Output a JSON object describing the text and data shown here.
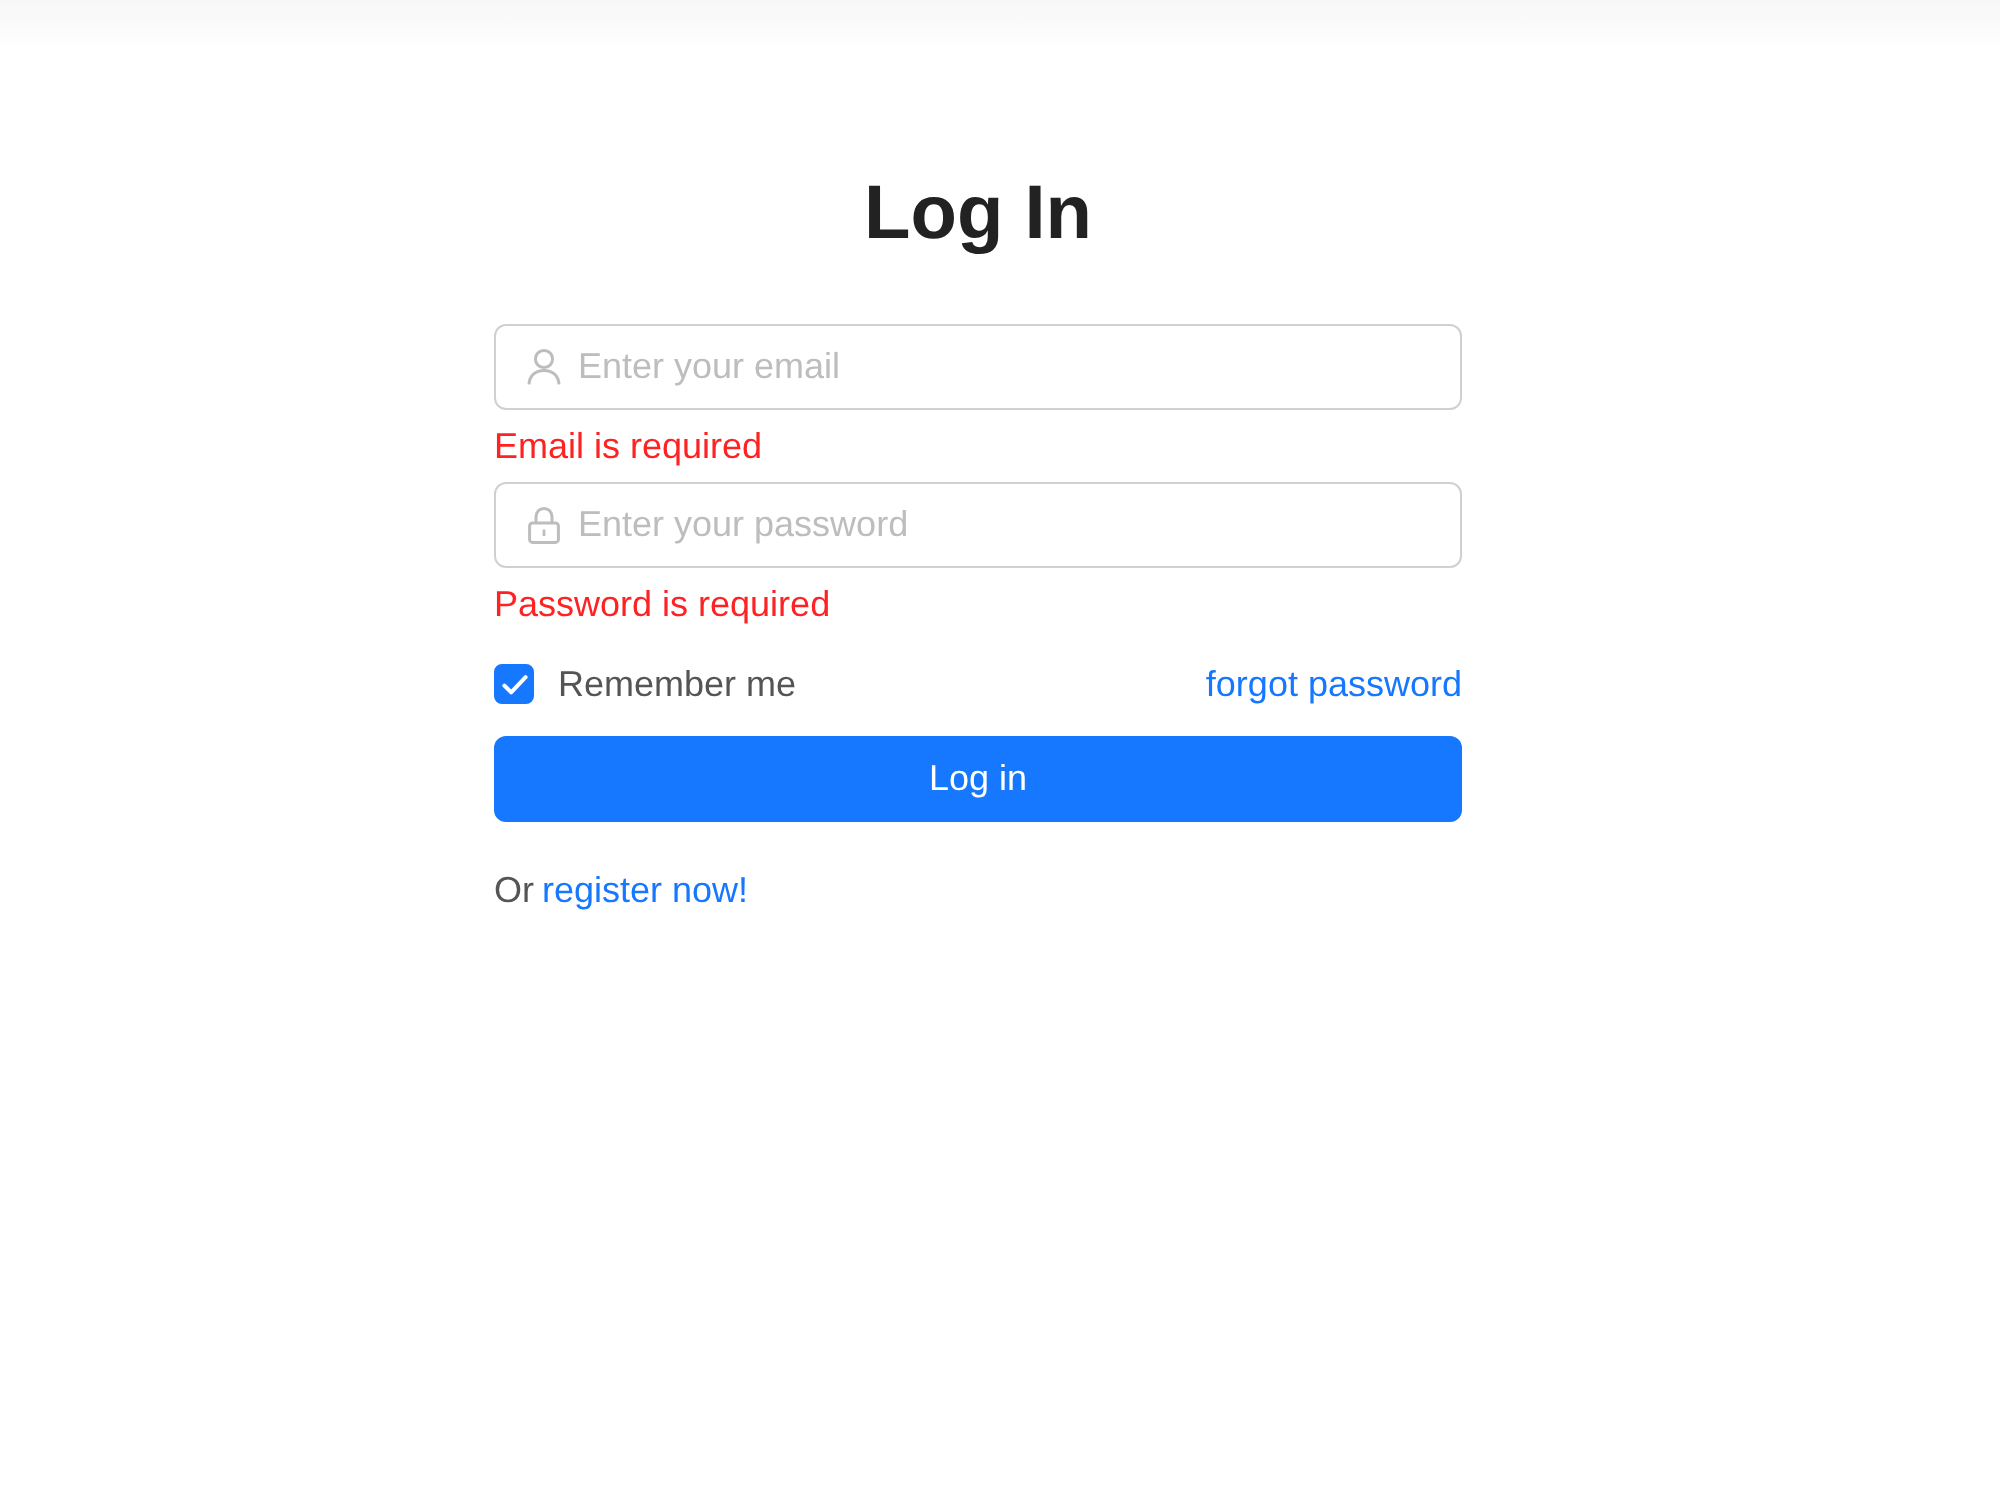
{
  "title": "Log In",
  "fields": [
    {
      "kind": "email",
      "placeholder": "Enter your email",
      "error": "Email is required"
    },
    {
      "kind": "password",
      "placeholder": "Enter your password",
      "error": "Password is required"
    }
  ],
  "remember": {
    "label": "Remember me",
    "checked": true
  },
  "forgot_link": "forgot password",
  "submit_button": "Log in",
  "register": {
    "prefix": "Or",
    "link": "register now!"
  }
}
